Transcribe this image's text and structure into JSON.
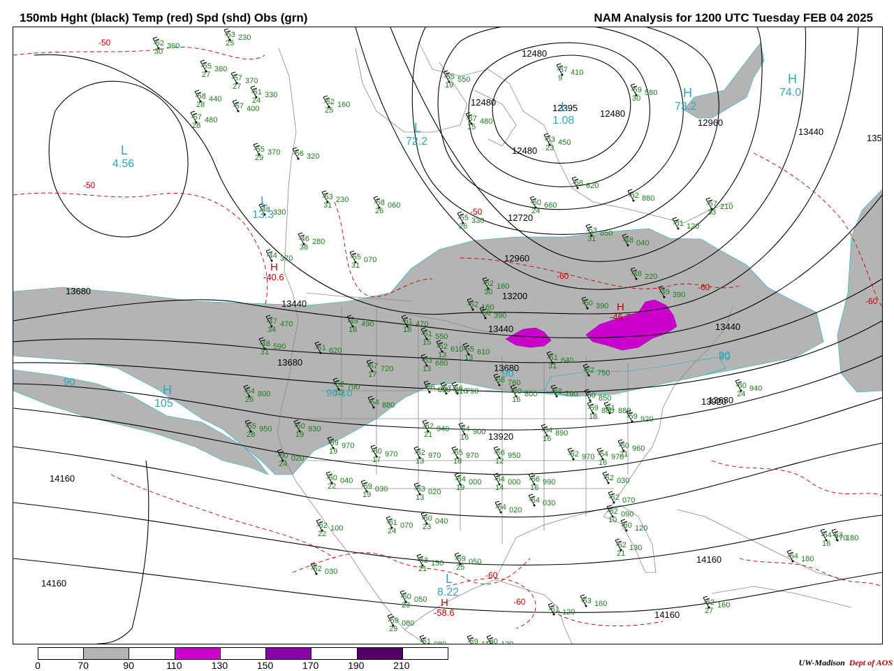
{
  "header": {
    "left_title": "150mb Hght (black) Temp (red) Spd (shd) Obs (grn)",
    "right_title": "NAM Analysis for 1200 UTC Tuesday  FEB 04 2025"
  },
  "colors": {
    "height_contour": "#000000",
    "temp_contour": "#c00000",
    "obs": "#1a7a1a",
    "geography": "#888888",
    "center_label": "#2aa8b8",
    "high_temp_label": "#c00000",
    "speed_70_90": "#b4b4b4",
    "speed_110_130": "#cc00cc",
    "speed_150_170": "#8800aa",
    "speed_190_210": "#550066"
  },
  "height_labels": [
    "12480",
    "12480",
    "12395",
    "12480",
    "12480",
    "12960",
    "13440",
    "135",
    "12720",
    "12960",
    "13200",
    "13440",
    "13440",
    "13680",
    "13680",
    "13680",
    "13440",
    "13680",
    "13920",
    "13920",
    "14160",
    "14160",
    "14160",
    "14160"
  ],
  "temp_labels": [
    "-50",
    "-50",
    "-50",
    "-60",
    "-60",
    "-60",
    "-60",
    "-60"
  ],
  "centers": [
    {
      "letter": "L",
      "value": "4.56"
    },
    {
      "letter": "L",
      "value": "1.08"
    },
    {
      "letter": "L",
      "value": "72.2"
    },
    {
      "letter": "H",
      "value": "73.2"
    },
    {
      "letter": "H",
      "value": "74.0"
    },
    {
      "letter": "L",
      "value": "13.3"
    },
    {
      "letter": "H",
      "value": "105"
    },
    {
      "letter": "L",
      "value": "8.22"
    }
  ],
  "warm_centers": [
    {
      "letter": "H",
      "value": "-40.6"
    },
    {
      "letter": "H",
      "value": "-58.6"
    },
    {
      "letter": "H",
      "value": "-46.7"
    }
  ],
  "speed_labels": [
    "90",
    "90",
    "90",
    "96.10",
    "90"
  ],
  "obs_stations": [
    {
      "t": "-52",
      "d": "30",
      "h": "360"
    },
    {
      "t": "-53",
      "d": "25",
      "h": "230"
    },
    {
      "t": "-55",
      "d": "27",
      "h": "380"
    },
    {
      "t": "-57",
      "d": "27",
      "h": "370"
    },
    {
      "t": "-58",
      "d": "28",
      "h": "440"
    },
    {
      "t": "-61",
      "d": "24",
      "h": "330"
    },
    {
      "t": "-57",
      "d": "",
      "h": "400"
    },
    {
      "t": "-57",
      "d": "28",
      "h": "480"
    },
    {
      "t": "-62",
      "d": "25",
      "h": "160"
    },
    {
      "t": "-65",
      "d": "19",
      "h": "550"
    },
    {
      "t": "-67",
      "d": "9",
      "h": "410"
    },
    {
      "t": "-67",
      "d": "15",
      "h": "480"
    },
    {
      "t": "-63",
      "d": "23",
      "h": "450"
    },
    {
      "t": "-59",
      "d": "30",
      "h": "580"
    },
    {
      "t": "-55",
      "d": "29",
      "h": "370"
    },
    {
      "t": "-56",
      "d": "",
      "h": "320"
    },
    {
      "t": "-53",
      "d": "31",
      "h": "230"
    },
    {
      "t": "-58",
      "d": "26",
      "h": "060"
    },
    {
      "t": "-58",
      "d": "",
      "h": "620"
    },
    {
      "t": "-60",
      "d": "24",
      "h": "660"
    },
    {
      "t": "-52",
      "d": "",
      "h": "880"
    },
    {
      "t": "-57",
      "d": "33",
      "h": "210"
    },
    {
      "t": "-51",
      "d": "",
      "h": "120"
    },
    {
      "t": "-48",
      "d": "",
      "h": "330"
    },
    {
      "t": "-46",
      "d": "38",
      "h": "280"
    },
    {
      "t": "-55",
      "d": "26",
      "h": "330"
    },
    {
      "t": "-53",
      "d": "31",
      "h": "850"
    },
    {
      "t": "-48",
      "d": "",
      "h": "040"
    },
    {
      "t": "-48",
      "d": "",
      "h": "220"
    },
    {
      "t": "-49",
      "d": "",
      "h": "390"
    },
    {
      "t": "-44",
      "d": "",
      "h": "370"
    },
    {
      "t": "-55",
      "d": "31",
      "h": "070"
    },
    {
      "t": "-52",
      "d": "30",
      "h": "160"
    },
    {
      "t": "-62",
      "d": "",
      "h": "160"
    },
    {
      "t": "-50",
      "d": "",
      "h": "390"
    },
    {
      "t": "-47",
      "d": "34",
      "h": "470"
    },
    {
      "t": "-49",
      "d": "16",
      "h": "490"
    },
    {
      "t": "-51",
      "d": "18",
      "h": "470"
    },
    {
      "t": "-50",
      "d": "",
      "h": "390"
    },
    {
      "t": "-51",
      "d": "15",
      "h": "550"
    },
    {
      "t": "-48",
      "d": "31",
      "h": "590"
    },
    {
      "t": "-51",
      "d": "",
      "h": "620"
    },
    {
      "t": "-52",
      "d": "13",
      "h": "610"
    },
    {
      "t": "-55",
      "d": "13",
      "h": "610"
    },
    {
      "t": "-57",
      "d": "17",
      "h": "720"
    },
    {
      "t": "-53",
      "d": "13",
      "h": "680"
    },
    {
      "t": "-51",
      "d": "31",
      "h": "640"
    },
    {
      "t": "-52",
      "d": "",
      "h": "750"
    },
    {
      "t": "-54",
      "d": "",
      "h": "880"
    },
    {
      "t": "-57",
      "d": "",
      "h": "810"
    },
    {
      "t": "-54",
      "d": "26",
      "h": "800"
    },
    {
      "t": "-52",
      "d": "10",
      "h": "790"
    },
    {
      "t": "-56",
      "d": "",
      "h": "830"
    },
    {
      "t": "-56",
      "d": "",
      "h": "790"
    },
    {
      "t": "-58",
      "d": "",
      "h": "760"
    },
    {
      "t": "-60",
      "d": "16",
      "h": "800"
    },
    {
      "t": "-58",
      "d": "",
      "h": "790"
    },
    {
      "t": "-60",
      "d": "",
      "h": "850"
    },
    {
      "t": "-61",
      "d": "",
      "h": "880"
    },
    {
      "t": "-59",
      "d": "",
      "h": "920"
    },
    {
      "t": "-60",
      "d": "24",
      "h": "940"
    },
    {
      "t": "-59",
      "d": "18",
      "h": "880"
    },
    {
      "t": "-55",
      "d": "28",
      "h": "950"
    },
    {
      "t": "-60",
      "d": "19",
      "h": "930"
    },
    {
      "t": "-62",
      "d": "21",
      "h": "940"
    },
    {
      "t": "-64",
      "d": "16",
      "h": "900"
    },
    {
      "t": "-64",
      "d": "16",
      "h": "890"
    },
    {
      "t": "-59",
      "d": "19",
      "h": "970"
    },
    {
      "t": "-60",
      "d": "17",
      "h": "970"
    },
    {
      "t": "-62",
      "d": "13",
      "h": "970"
    },
    {
      "t": "-65",
      "d": "18",
      "h": "970"
    },
    {
      "t": "-66",
      "d": "12",
      "h": "950"
    },
    {
      "t": "-62",
      "d": "",
      "h": "970"
    },
    {
      "t": "-64",
      "d": "16",
      "h": "970"
    },
    {
      "t": "-60",
      "d": "21",
      "h": "960"
    },
    {
      "t": "-60",
      "d": "24",
      "h": "020"
    },
    {
      "t": "-60",
      "d": "22",
      "h": "040"
    },
    {
      "t": "-59",
      "d": "19",
      "h": "030"
    },
    {
      "t": "-63",
      "d": "13",
      "h": "020"
    },
    {
      "t": "-64",
      "d": "19",
      "h": "000"
    },
    {
      "t": "-64",
      "d": "14",
      "h": "000"
    },
    {
      "t": "-66",
      "d": "16",
      "h": "990"
    },
    {
      "t": "-62",
      "d": "",
      "h": "030"
    },
    {
      "t": "-62",
      "d": "22",
      "h": "100"
    },
    {
      "t": "-61",
      "d": "24",
      "h": "070"
    },
    {
      "t": "-60",
      "d": "23",
      "h": "040"
    },
    {
      "t": "-64",
      "d": "",
      "h": "020"
    },
    {
      "t": "-64",
      "d": "",
      "h": "030"
    },
    {
      "t": "-62",
      "d": "",
      "h": "070"
    },
    {
      "t": "-62",
      "d": "10",
      "h": "090"
    },
    {
      "t": "-60",
      "d": "",
      "h": "120"
    },
    {
      "t": "-62",
      "d": "21",
      "h": "130"
    },
    {
      "t": "-62",
      "d": "",
      "h": "030"
    },
    {
      "t": "-63",
      "d": "21",
      "h": "150"
    },
    {
      "t": "-59",
      "d": "25",
      "h": "050"
    },
    {
      "t": "-60",
      "d": "23",
      "h": "050"
    },
    {
      "t": "-59",
      "d": "29",
      "h": "080"
    },
    {
      "t": "-61",
      "d": "26",
      "h": "080"
    },
    {
      "t": "-59",
      "d": "",
      "h": "110"
    },
    {
      "t": "-60",
      "d": "",
      "h": "120"
    },
    {
      "t": "-61",
      "d": "",
      "h": "120"
    },
    {
      "t": "-63",
      "d": "",
      "h": "160"
    },
    {
      "t": "-62",
      "d": "27",
      "h": "160"
    },
    {
      "t": "-64",
      "d": "",
      "h": "180"
    },
    {
      "t": "-64",
      "d": "16",
      "h": "170"
    },
    {
      "t": "-63",
      "d": "",
      "h": "180"
    }
  ],
  "legend": {
    "ticks": [
      "0",
      "70",
      "90",
      "110",
      "130",
      "150",
      "170",
      "190",
      "210"
    ],
    "fills": [
      "#ffffff",
      "#b4b4b4",
      "#ffffff",
      "#cc00cc",
      "#ffffff",
      "#8800aa",
      "#ffffff",
      "#550066",
      "#ffffff"
    ]
  },
  "credit": {
    "org": "UW-Madison",
    "dept": "Dept of AOS"
  }
}
